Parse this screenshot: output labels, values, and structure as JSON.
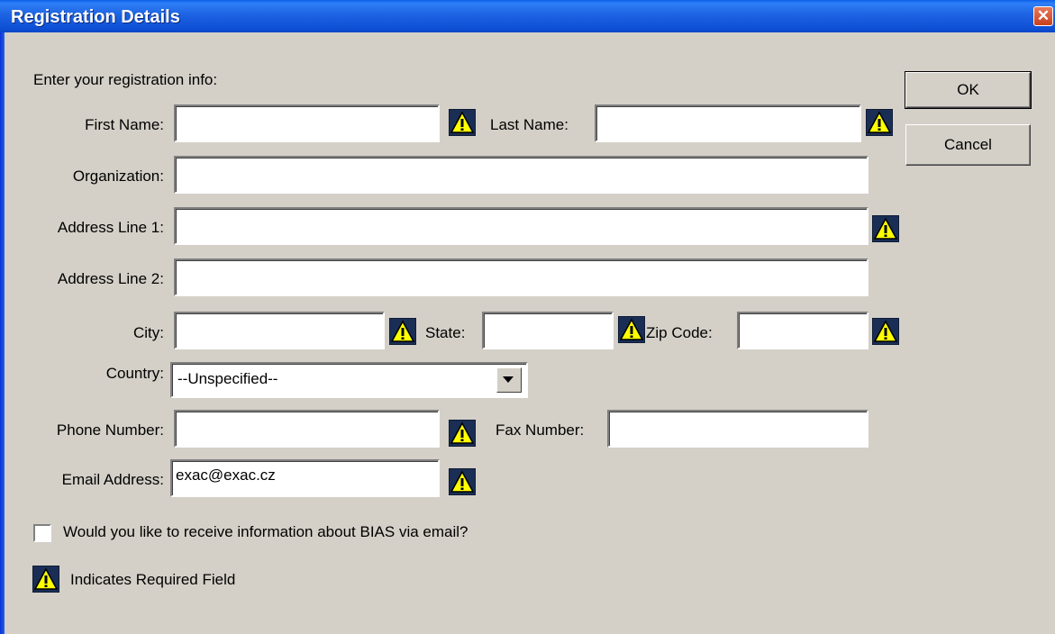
{
  "window": {
    "title": "Registration Details"
  },
  "intro": "Enter your registration info:",
  "fields": {
    "first_name": {
      "label": "First Name:",
      "value": ""
    },
    "last_name": {
      "label": "Last Name:",
      "value": ""
    },
    "organization": {
      "label": "Organization:",
      "value": ""
    },
    "address1": {
      "label": "Address Line 1:",
      "value": ""
    },
    "address2": {
      "label": "Address Line 2:",
      "value": ""
    },
    "city": {
      "label": "City:",
      "value": ""
    },
    "state": {
      "label": "State:",
      "value": ""
    },
    "zip": {
      "label": "Zip Code:",
      "value": ""
    },
    "country": {
      "label": "Country:",
      "value": "--Unspecified--"
    },
    "phone": {
      "label": "Phone Number:",
      "value": ""
    },
    "fax": {
      "label": "Fax Number:",
      "value": ""
    },
    "email": {
      "label": "Email Address:",
      "value": "exac@exac.cz"
    }
  },
  "buttons": {
    "ok": "OK",
    "cancel": "Cancel"
  },
  "checkbox": {
    "label": "Would you like to receive information about BIAS via email?",
    "checked": false
  },
  "legend": {
    "text": "Indicates Required Field"
  },
  "icons": {
    "required": "warning-triangle-icon",
    "close": "close-icon",
    "dropdown": "chevron-down-icon"
  },
  "colors": {
    "titlebar": "#0a5ee8",
    "dialog_bg": "#d4d0c8",
    "warning_yellow": "#ffff00"
  }
}
